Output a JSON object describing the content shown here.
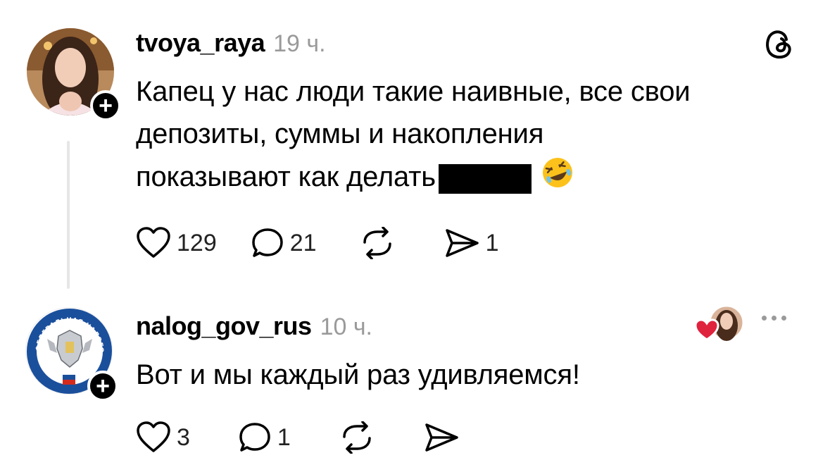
{
  "posts": [
    {
      "username": "tvoya_raya",
      "time": "19 ч.",
      "text_line1": "Капец у нас люди такие наивные, все свои",
      "text_line2": "депозиты, суммы и накопления",
      "text_line3": "показывают как делать",
      "emoji": "rofl-emoji",
      "likes": "129",
      "replies": "21",
      "shares": "1"
    },
    {
      "username": "nalog_gov_rus",
      "time": "10 ч.",
      "text_line1": "Вот и мы каждый раз удивляемся!",
      "likes": "3",
      "replies": "1",
      "avatar_seal_text": "ФЕДЕРАЛЬНАЯ НАЛОГОВАЯ СЛУЖБА"
    }
  ],
  "follow_badge": "+",
  "colors": {
    "accent_heart": "#e0233d",
    "muted": "#9a9a9a",
    "seal_blue": "#1a4f9c"
  }
}
